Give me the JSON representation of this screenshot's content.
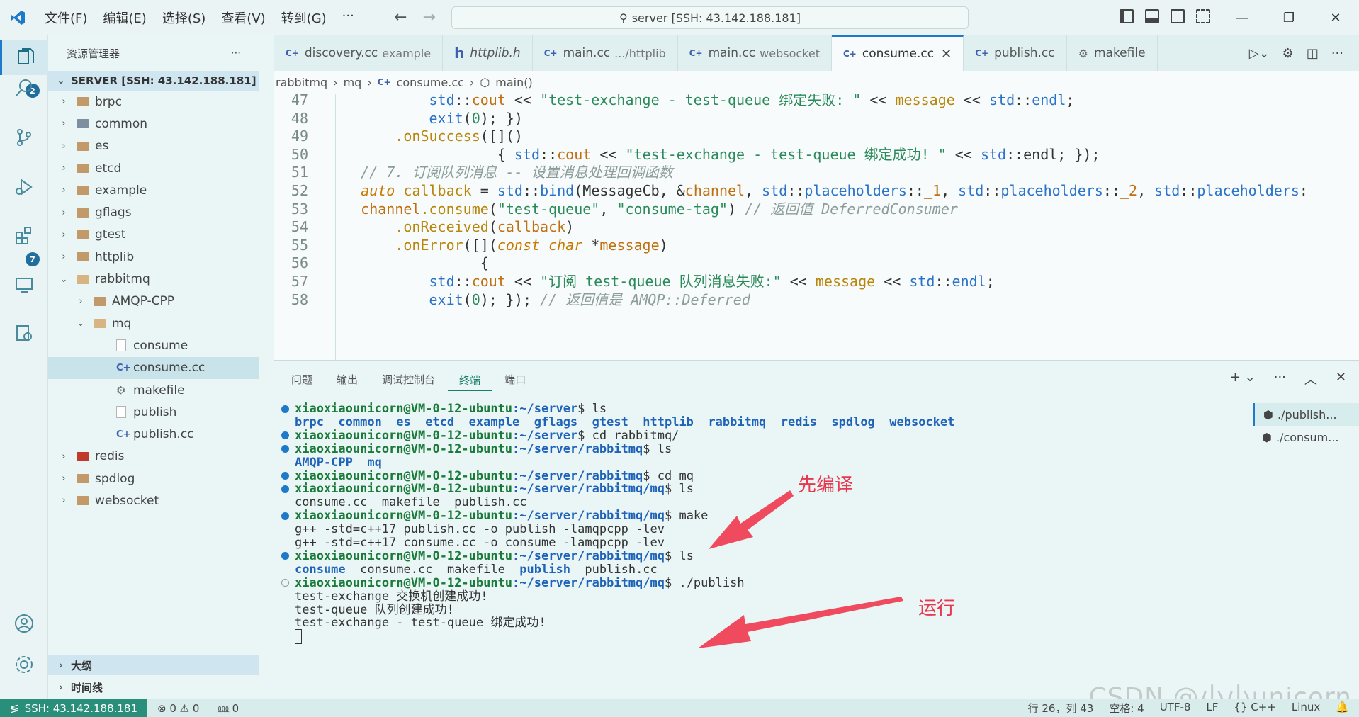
{
  "menu": [
    "文件(F)",
    "编辑(E)",
    "选择(S)",
    "查看(V)",
    "转到(G)",
    "···"
  ],
  "command_center": "server [SSH: 43.142.188.181]",
  "window_controls": [
    "—",
    "❐",
    "✕"
  ],
  "activity_badges": {
    "explorer": "2",
    "extensions": "7"
  },
  "sidebar": {
    "title": "资源管理器",
    "more": "···",
    "section": "SERVER [SSH: 43.142.188.181]",
    "tree": [
      {
        "label": "brpc",
        "kind": "folder",
        "depth": 0,
        "open": false
      },
      {
        "label": "common",
        "kind": "folder-common",
        "depth": 0,
        "open": false
      },
      {
        "label": "es",
        "kind": "folder",
        "depth": 0,
        "open": false
      },
      {
        "label": "etcd",
        "kind": "folder",
        "depth": 0,
        "open": false
      },
      {
        "label": "example",
        "kind": "folder",
        "depth": 0,
        "open": false
      },
      {
        "label": "gflags",
        "kind": "folder",
        "depth": 0,
        "open": false
      },
      {
        "label": "gtest",
        "kind": "folder",
        "depth": 0,
        "open": false
      },
      {
        "label": "httplib",
        "kind": "folder",
        "depth": 0,
        "open": false
      },
      {
        "label": "rabbitmq",
        "kind": "folder",
        "depth": 0,
        "open": true
      },
      {
        "label": "AMQP-CPP",
        "kind": "folder",
        "depth": 1,
        "open": false
      },
      {
        "label": "mq",
        "kind": "folder",
        "depth": 1,
        "open": true
      },
      {
        "label": "consume",
        "kind": "file",
        "depth": 2
      },
      {
        "label": "consume.cc",
        "kind": "cpp",
        "depth": 2,
        "selected": true
      },
      {
        "label": "makefile",
        "kind": "make",
        "depth": 2
      },
      {
        "label": "publish",
        "kind": "file",
        "depth": 2
      },
      {
        "label": "publish.cc",
        "kind": "cpp",
        "depth": 2
      },
      {
        "label": "redis",
        "kind": "folder-redis",
        "depth": 0,
        "open": false
      },
      {
        "label": "spdlog",
        "kind": "folder",
        "depth": 0,
        "open": false
      },
      {
        "label": "websocket",
        "kind": "folder",
        "depth": 0,
        "open": false
      }
    ],
    "outline": "大纲",
    "timeline": "时间线"
  },
  "tabs": [
    {
      "icon": "C++",
      "label": "discovery.cc",
      "desc": "example"
    },
    {
      "icon": "h",
      "label": "httplib.h",
      "desc": "",
      "italic": true
    },
    {
      "icon": "C++",
      "label": "main.cc",
      "desc": ".../httplib"
    },
    {
      "icon": "C++",
      "label": "main.cc",
      "desc": "websocket"
    },
    {
      "icon": "C++",
      "label": "consume.cc",
      "desc": "",
      "active": true
    },
    {
      "icon": "C++",
      "label": "publish.cc",
      "desc": ""
    },
    {
      "icon": "make",
      "label": "makefile",
      "desc": ""
    }
  ],
  "breadcrumb": [
    "rabbitmq",
    "mq",
    "consume.cc",
    "main()"
  ],
  "code": [
    {
      "n": "47",
      "indent": 8,
      "parts": [
        [
          "ns",
          "std"
        ],
        [
          "pl",
          "::"
        ],
        [
          "id",
          "cout"
        ],
        [
          "pl",
          " << "
        ],
        [
          "str",
          "\"test-exchange - test-queue 绑定失败: \""
        ],
        [
          "pl",
          " << "
        ],
        [
          "fn",
          "message"
        ],
        [
          "pl",
          " << "
        ],
        [
          "ns",
          "std"
        ],
        [
          "pl",
          "::"
        ],
        [
          "ns",
          "endl"
        ],
        [
          "pl",
          ";"
        ]
      ]
    },
    {
      "n": "48",
      "indent": 8,
      "parts": [
        [
          "ns",
          "exit"
        ],
        [
          "pl",
          "("
        ],
        [
          "str",
          "0"
        ],
        [
          "pl",
          "); })"
        ]
      ]
    },
    {
      "n": "49",
      "indent": 4,
      "parts": [
        [
          "fn",
          ".onSuccess"
        ],
        [
          "pl",
          "([]()"
        ]
      ]
    },
    {
      "n": "50",
      "indent": 16,
      "parts": [
        [
          "pl",
          "{ "
        ],
        [
          "ns",
          "std"
        ],
        [
          "pl",
          "::"
        ],
        [
          "id",
          "cout"
        ],
        [
          "pl",
          " << "
        ],
        [
          "str",
          "\"test-exchange - test-queue 绑定成功! \""
        ],
        [
          "pl",
          " << "
        ],
        [
          "ns",
          "std"
        ],
        [
          "pl",
          "::endl; });"
        ]
      ]
    },
    {
      "n": "51",
      "indent": 0,
      "parts": [
        [
          "cm",
          "// 7. 订阅队列消息 -- 设置消息处理回调函数"
        ]
      ]
    },
    {
      "n": "52",
      "indent": 0,
      "parts": [
        [
          "kw",
          "auto"
        ],
        [
          "pl",
          " "
        ],
        [
          "fn",
          "callback"
        ],
        [
          "pl",
          " = "
        ],
        [
          "ns",
          "std"
        ],
        [
          "pl",
          "::"
        ],
        [
          "ns",
          "bind"
        ],
        [
          "pl",
          "(MessageCb, &"
        ],
        [
          "id",
          "channel"
        ],
        [
          "pl",
          ", "
        ],
        [
          "ns",
          "std"
        ],
        [
          "pl",
          "::"
        ],
        [
          "ns",
          "placeholders"
        ],
        [
          "pl",
          "::"
        ],
        [
          "id",
          "_1"
        ],
        [
          "pl",
          ", "
        ],
        [
          "ns",
          "std"
        ],
        [
          "pl",
          "::"
        ],
        [
          "ns",
          "placeholders"
        ],
        [
          "pl",
          "::"
        ],
        [
          "id",
          "_2"
        ],
        [
          "pl",
          ", "
        ],
        [
          "ns",
          "std"
        ],
        [
          "pl",
          "::"
        ],
        [
          "ns",
          "placeholders"
        ],
        [
          "pl",
          ":"
        ]
      ]
    },
    {
      "n": "53",
      "indent": 0,
      "parts": [
        [
          "id",
          "channel"
        ],
        [
          "fn",
          ".consume"
        ],
        [
          "pl",
          "("
        ],
        [
          "str",
          "\"test-queue\""
        ],
        [
          "pl",
          ", "
        ],
        [
          "str",
          "\"consume-tag\""
        ],
        [
          "pl",
          ") "
        ],
        [
          "cm",
          "// 返回值 DeferredConsumer"
        ]
      ]
    },
    {
      "n": "54",
      "indent": 4,
      "parts": [
        [
          "fn",
          ".onReceived"
        ],
        [
          "pl",
          "("
        ],
        [
          "id",
          "callback"
        ],
        [
          "pl",
          ")"
        ]
      ]
    },
    {
      "n": "55",
      "indent": 4,
      "parts": [
        [
          "fn",
          ".onError"
        ],
        [
          "pl",
          "([]("
        ],
        [
          "kw",
          "const char"
        ],
        [
          "pl",
          " *"
        ],
        [
          "id",
          "message"
        ],
        [
          "pl",
          ")"
        ]
      ]
    },
    {
      "n": "56",
      "indent": 14,
      "parts": [
        [
          "pl",
          "{"
        ]
      ]
    },
    {
      "n": "57",
      "indent": 8,
      "parts": [
        [
          "ns",
          "std"
        ],
        [
          "pl",
          "::"
        ],
        [
          "id",
          "cout"
        ],
        [
          "pl",
          " << "
        ],
        [
          "str",
          "\"订阅 test-queue 队列消息失败:\""
        ],
        [
          "pl",
          " << "
        ],
        [
          "fn",
          "message"
        ],
        [
          "pl",
          " << "
        ],
        [
          "ns",
          "std"
        ],
        [
          "pl",
          "::"
        ],
        [
          "ns",
          "endl"
        ],
        [
          "pl",
          ";"
        ]
      ]
    },
    {
      "n": "58",
      "indent": 8,
      "parts": [
        [
          "ns",
          "exit"
        ],
        [
          "pl",
          "("
        ],
        [
          "str",
          "0"
        ],
        [
          "pl",
          "); }); "
        ],
        [
          "cm",
          "// 返回值是 AMQP::Deferred"
        ]
      ]
    }
  ],
  "panel": {
    "tabs": [
      "问题",
      "输出",
      "调试控制台",
      "终端",
      "端口"
    ],
    "active_tab": "终端",
    "actions": [
      "+ ⌄",
      "···",
      "︿",
      "✕"
    ],
    "terminals": [
      "./publish...",
      "./consum..."
    ]
  },
  "terminal": [
    {
      "dot": "blue",
      "prompt": "xiaoxiaounicorn@VM-0-12-ubuntu",
      "path": ":~/server",
      "cmd": "$ ls"
    },
    {
      "dot": "none",
      "dirs": "brpc  common  es  etcd  example  gflags  gtest  httplib  rabbitmq  redis  spdlog  websocket"
    },
    {
      "dot": "blue",
      "prompt": "xiaoxiaounicorn@VM-0-12-ubuntu",
      "path": ":~/server",
      "cmd": "$ cd rabbitmq/"
    },
    {
      "dot": "blue",
      "prompt": "xiaoxiaounicorn@VM-0-12-ubuntu",
      "path": ":~/server/rabbitmq",
      "cmd": "$ ls"
    },
    {
      "dot": "none",
      "dirs": "AMQP-CPP  mq"
    },
    {
      "dot": "blue",
      "prompt": "xiaoxiaounicorn@VM-0-12-ubuntu",
      "path": ":~/server/rabbitmq",
      "cmd": "$ cd mq"
    },
    {
      "dot": "blue",
      "prompt": "xiaoxiaounicorn@VM-0-12-ubuntu",
      "path": ":~/server/rabbitmq/mq",
      "cmd": "$ ls"
    },
    {
      "dot": "none",
      "out": "consume.cc  makefile  publish.cc"
    },
    {
      "dot": "blue",
      "prompt": "xiaoxiaounicorn@VM-0-12-ubuntu",
      "path": ":~/server/rabbitmq/mq",
      "cmd": "$ make"
    },
    {
      "dot": "none",
      "out": "g++ -std=c++17 publish.cc -o publish -lamqpcpp -lev"
    },
    {
      "dot": "none",
      "out": "g++ -std=c++17 consume.cc -o consume -lamqpcpp -lev"
    },
    {
      "dot": "blue",
      "prompt": "xiaoxiaounicorn@VM-0-12-ubuntu",
      "path": ":~/server/rabbitmq/mq",
      "cmd": "$ ls"
    },
    {
      "dot": "none",
      "mixed": [
        [
          "dir",
          "consume"
        ],
        [
          "out",
          "  consume.cc  makefile  "
        ],
        [
          "dir",
          "publish"
        ],
        [
          "out",
          "  publish.cc"
        ]
      ]
    },
    {
      "dot": "hollow",
      "prompt": "xiaoxiaounicorn@VM-0-12-ubuntu",
      "path": ":~/server/rabbitmq/mq",
      "cmd": "$ ./publish"
    },
    {
      "dot": "none",
      "out": "test-exchange 交换机创建成功!"
    },
    {
      "dot": "none",
      "out": "test-queue 队列创建成功!"
    },
    {
      "dot": "none",
      "out": "test-exchange - test-queue 绑定成功!"
    },
    {
      "dot": "none",
      "cursor": true
    }
  ],
  "annotations": {
    "compile": "先编译",
    "run": "运行"
  },
  "annotation_color": "#e8384f",
  "status": {
    "remote": "SSH: 43.142.188.181",
    "problems": "⊗ 0 ⚠ 0",
    "ports": "⅏ 0",
    "position": "行 26，列 43",
    "spaces": "空格: 4",
    "encoding": "UTF-8",
    "eol": "LF",
    "language": "{} C++",
    "os": "Linux",
    "bell": "🔔"
  },
  "watermark": "CSDN @小小unicorn"
}
